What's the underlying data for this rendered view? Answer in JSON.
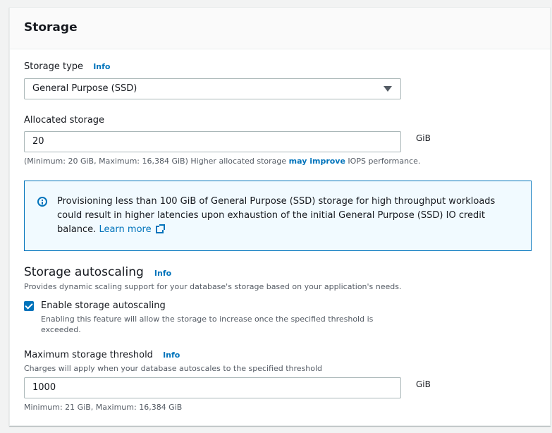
{
  "title": "Storage",
  "storage_type": {
    "label": "Storage type",
    "info": "Info",
    "value": "General Purpose (SSD)"
  },
  "allocated_storage": {
    "label": "Allocated storage",
    "value": "20",
    "unit": "GiB",
    "hint_before": "(Minimum: 20 GiB, Maximum: 16,384 GiB) Higher allocated storage ",
    "hint_link": "may improve",
    "hint_after": " IOPS performance."
  },
  "alert": {
    "text": "Provisioning less than 100 GiB of General Purpose (SSD) storage for high throughput workloads could result in higher latencies upon exhaustion of the initial General Purpose (SSD) IO credit balance. ",
    "link": "Learn more"
  },
  "autoscaling": {
    "title": "Storage autoscaling",
    "info": "Info",
    "description": "Provides dynamic scaling support for your database's storage based on your application's needs.",
    "checkbox_label": "Enable storage autoscaling",
    "checkbox_checked": true,
    "checkbox_hint": "Enabling this feature will allow the storage to increase once the specified threshold is exceeded."
  },
  "threshold": {
    "label": "Maximum storage threshold",
    "info": "Info",
    "description": "Charges will apply when your database autoscales to the specified threshold",
    "value": "1000",
    "unit": "GiB",
    "hint": "Minimum: 21 GiB, Maximum: 16,384 GiB"
  },
  "colors": {
    "accent": "#0073bb",
    "alert_bg": "#f1faff"
  }
}
